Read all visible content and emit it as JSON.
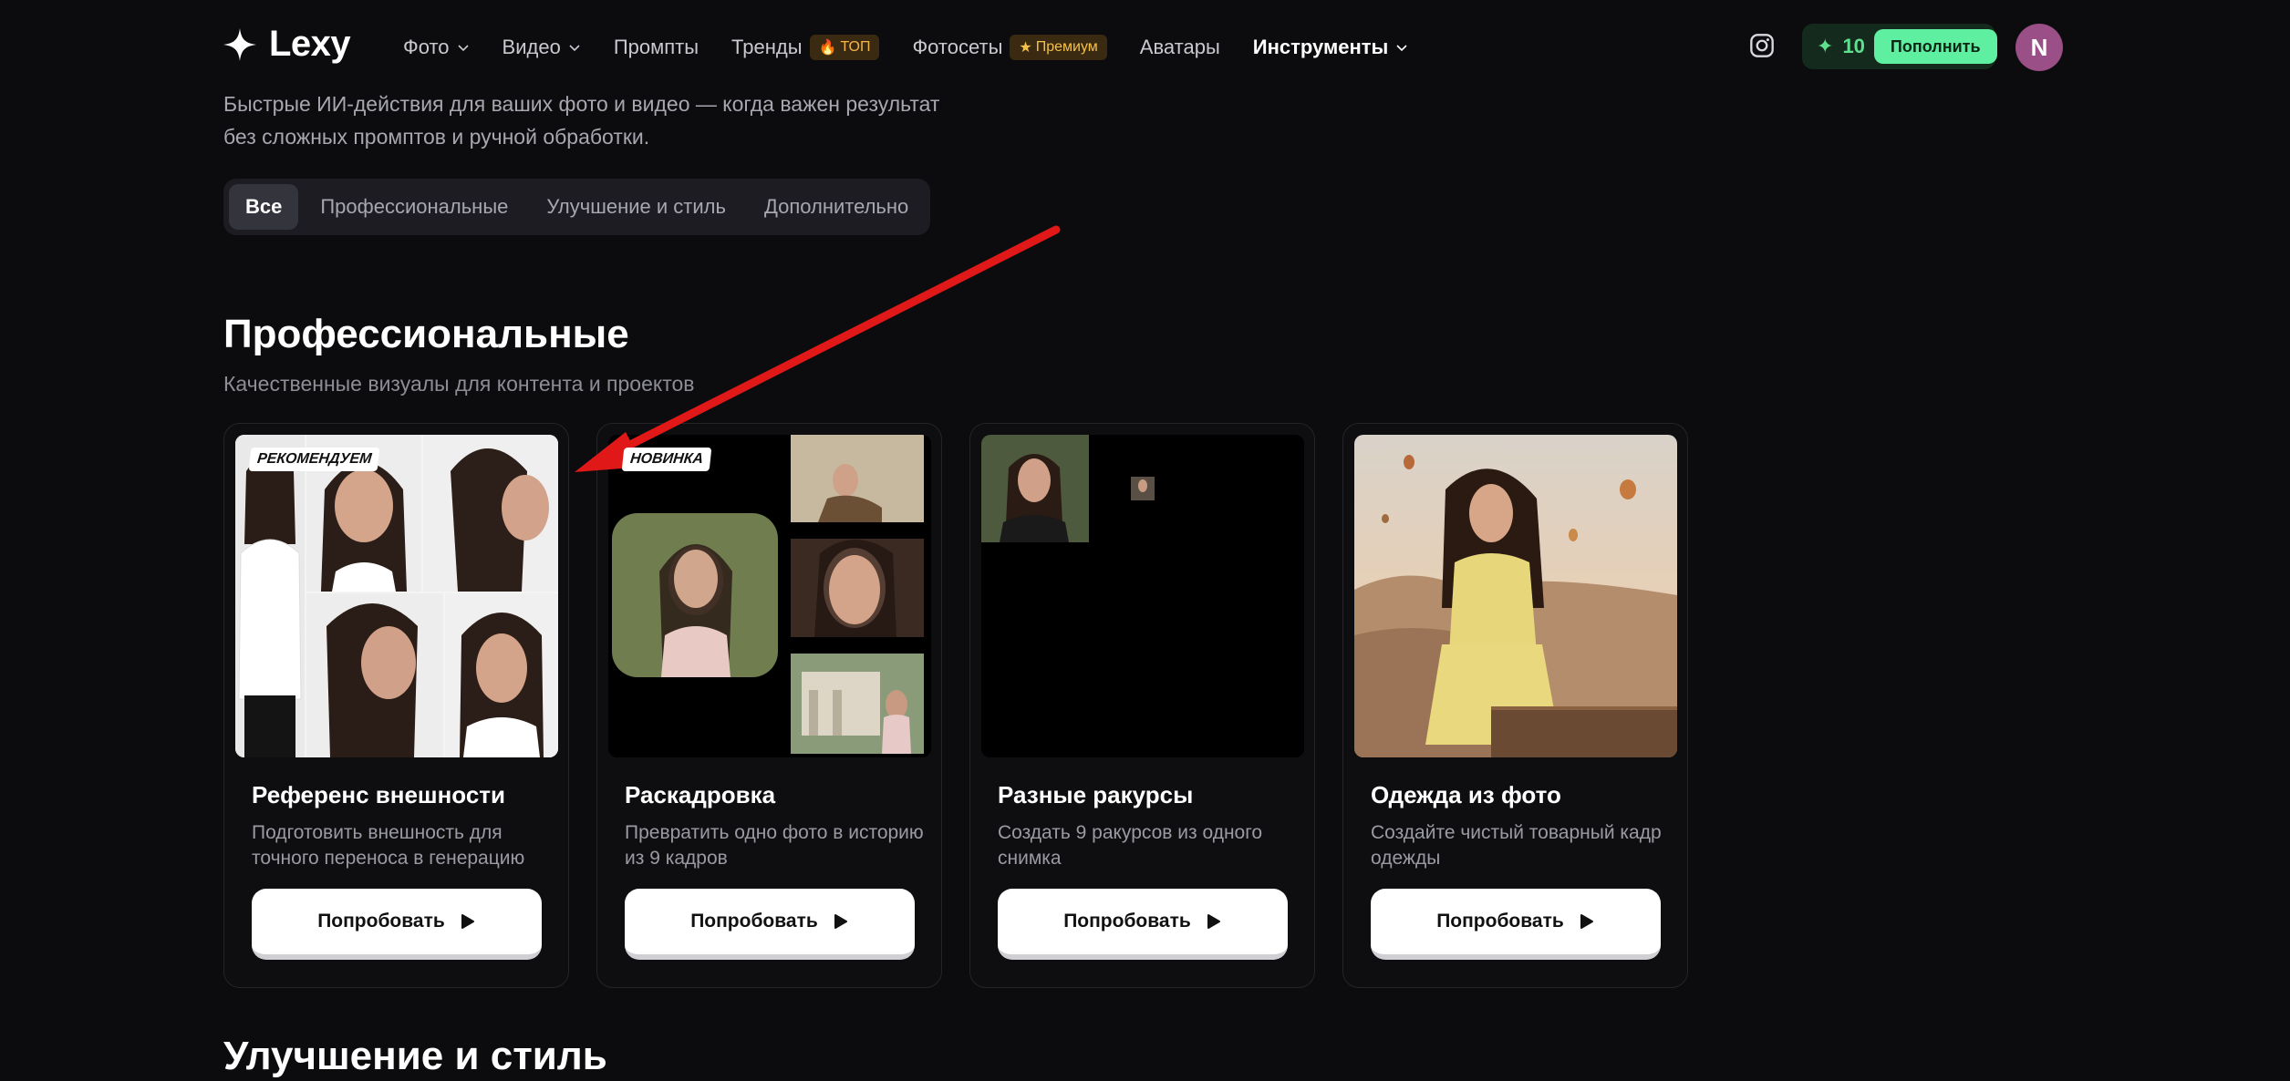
{
  "header": {
    "logo": "Lexy",
    "nav": [
      {
        "label": "Фото",
        "has_chevron": true
      },
      {
        "label": "Видео",
        "has_chevron": true
      },
      {
        "label": "Промпты",
        "has_chevron": false
      },
      {
        "label": "Тренды",
        "badge": "ТОП"
      },
      {
        "label": "Фотосеты",
        "badge": "Премиум"
      },
      {
        "label": "Аватары",
        "has_chevron": false
      },
      {
        "label": "Инструменты",
        "has_chevron": true,
        "active": true
      }
    ],
    "credits": {
      "count": "10",
      "topup_label": "Пополнить"
    },
    "avatar_initial": "N"
  },
  "intro": {
    "text_line1": "Быстрые ИИ-действия для ваших фото и видео — когда важен результат",
    "text_line2": "без сложных промптов и ручной обработки."
  },
  "filters": [
    {
      "label": "Все",
      "active": true
    },
    {
      "label": "Профессиональные"
    },
    {
      "label": "Улучшение и стиль"
    },
    {
      "label": "Дополнительно"
    }
  ],
  "section": {
    "title": "Профессиональные",
    "subtitle": "Качественные визуалы для контента и проектов",
    "cards": [
      {
        "tag": "РЕКОМЕНДУЕМ",
        "title": "Референс внешности",
        "desc": "Подготовить внешность для точного переноса в генерацию",
        "button": "Попробовать"
      },
      {
        "tag": "НОВИНКА",
        "title": "Раскадровка",
        "desc": "Превратить одно фото в историю из 9 кадров",
        "button": "Попробовать"
      },
      {
        "tag": "",
        "title": "Разные ракурсы",
        "desc": "Создать 9 ракурсов из одного снимка",
        "button": "Попробовать"
      },
      {
        "tag": "",
        "title": "Одежда из фото",
        "desc": "Создайте чистый товарный кадр одежды",
        "button": "Попробовать"
      }
    ]
  },
  "next_section": {
    "title": "Улучшение и стиль"
  },
  "colors": {
    "accent": "#5ef0a0",
    "arrow": "#e01818",
    "avatar": "#9a4f86"
  }
}
